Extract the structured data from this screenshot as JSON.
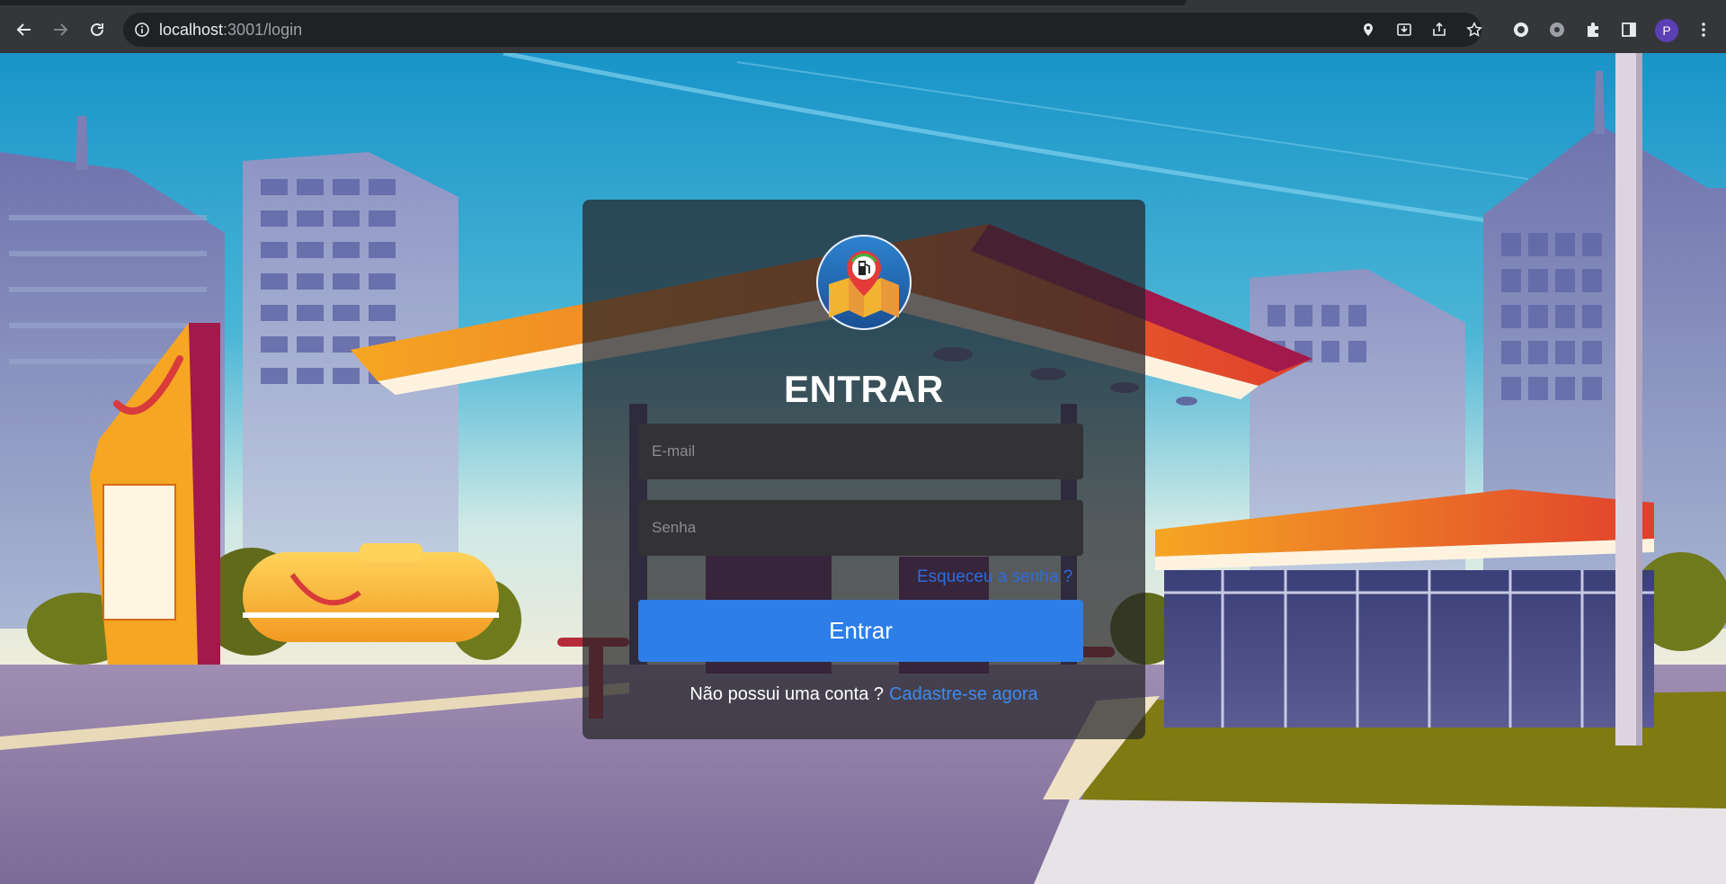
{
  "browser": {
    "url_host": "localhost",
    "url_path": ":3001/login",
    "profile_initial": "P",
    "icons": [
      "back-icon",
      "forward-icon",
      "reload-icon",
      "site-info-icon",
      "location-icon",
      "install-icon",
      "share-icon",
      "bookmark-star-icon",
      "extension-circle-icon",
      "extension-gear-icon",
      "extensions-puzzle-icon",
      "side-panel-icon",
      "menu-kebab-icon"
    ]
  },
  "login": {
    "title": "ENTRAR",
    "email_placeholder": "E-mail",
    "password_placeholder": "Senha",
    "forgot_link": "Esqueceu a senha ?",
    "submit_label": "Entrar",
    "no_account_text": "Não possui uma conta ?",
    "signup_link": "Cadastre-se agora"
  },
  "colors": {
    "primary_button": "#2d7ee8",
    "link": "#3d8bf0",
    "card_bg": "rgba(36,36,40,0.72)"
  }
}
